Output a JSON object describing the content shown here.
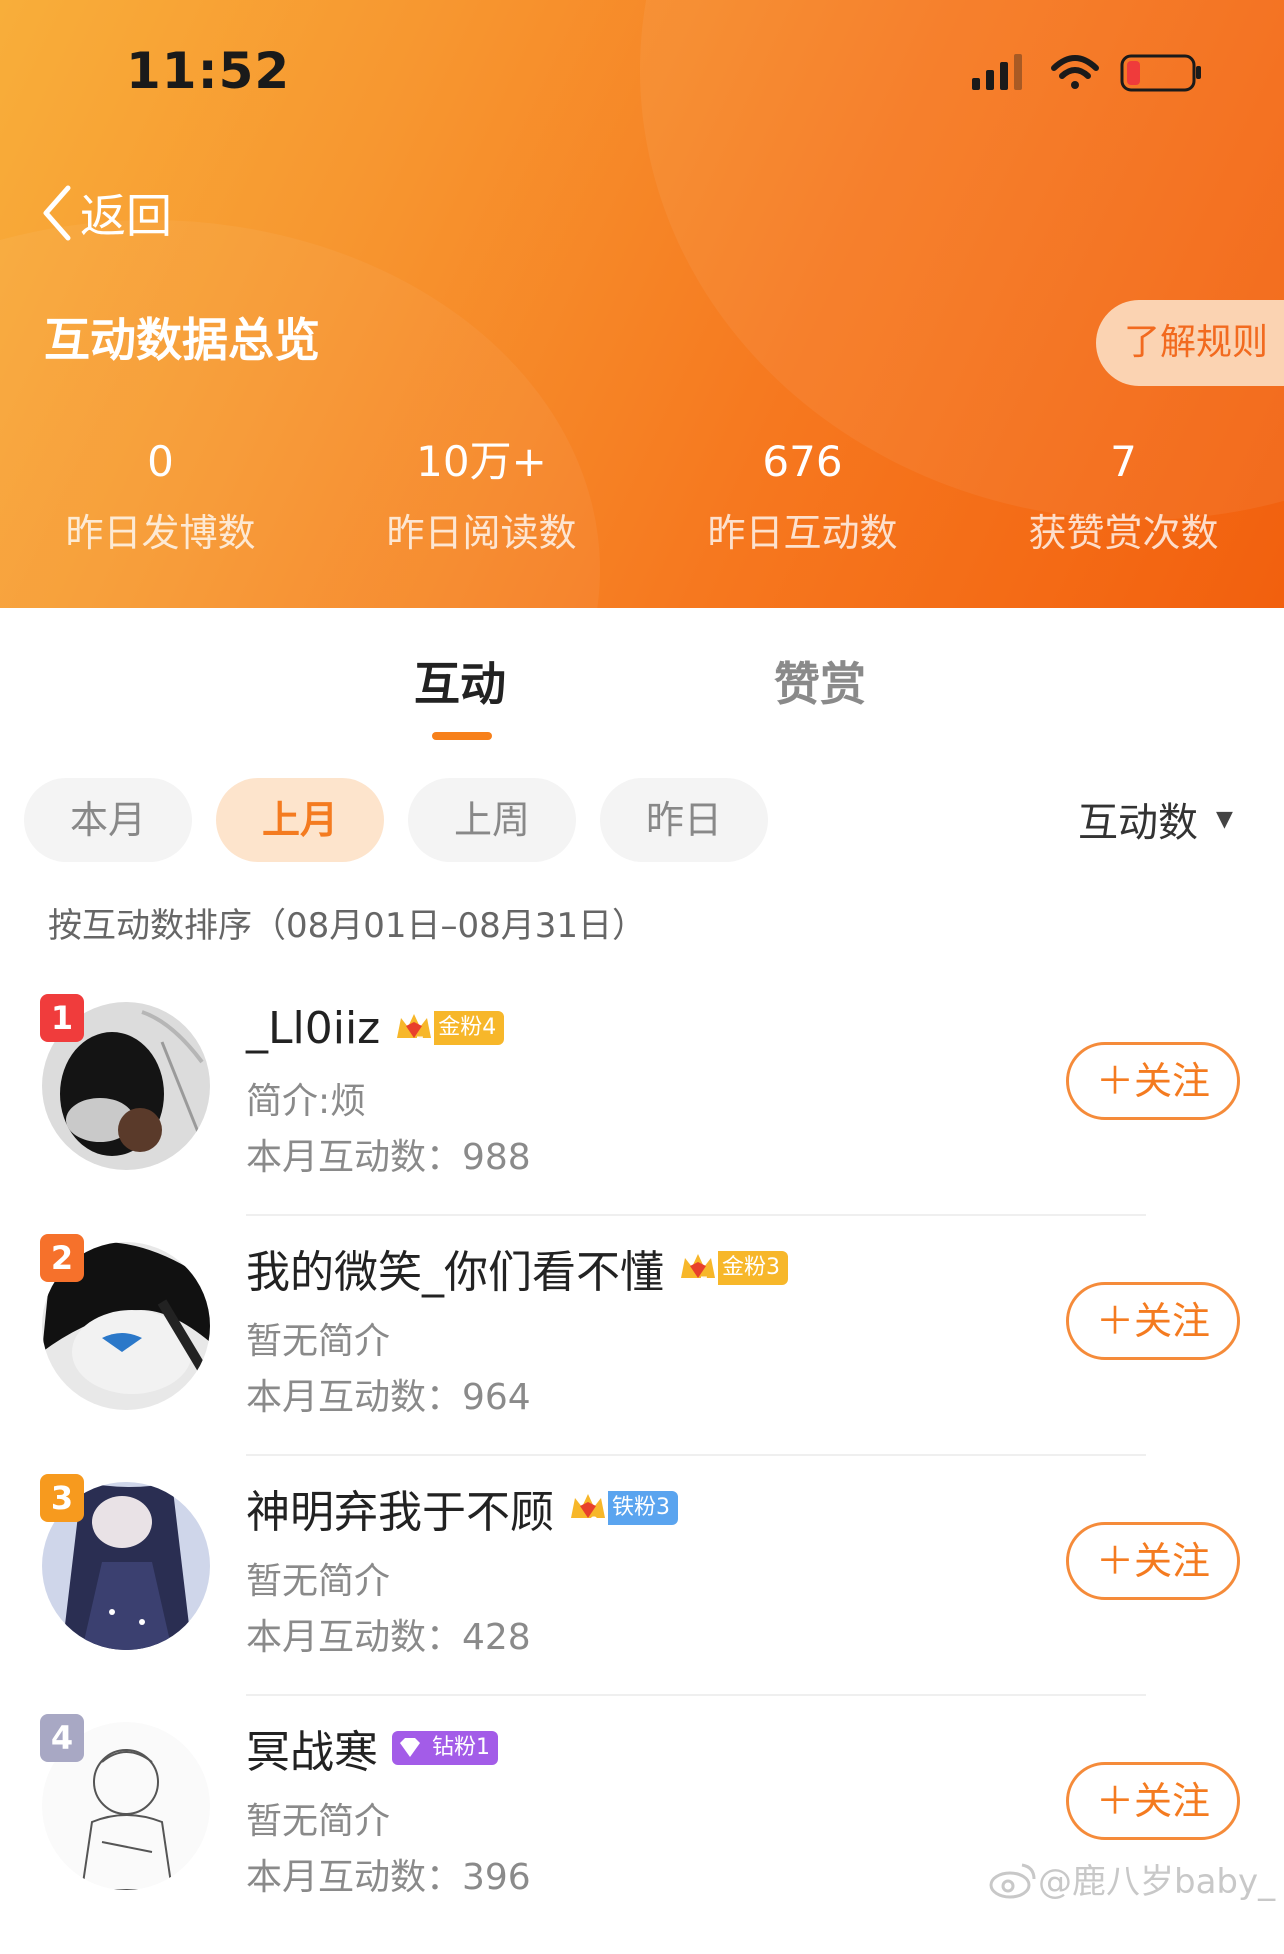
{
  "status_bar": {
    "time": "11:52"
  },
  "nav": {
    "back_label": "返回"
  },
  "header": {
    "title": "互动数据总览",
    "rule_button": "了解规则",
    "stats": [
      {
        "value": "0",
        "label": "昨日发博数"
      },
      {
        "value": "10万+",
        "label": "昨日阅读数"
      },
      {
        "value": "676",
        "label": "昨日互动数"
      },
      {
        "value": "7",
        "label": "获赞赏次数"
      }
    ]
  },
  "tabs": [
    {
      "label": "互动",
      "active": true
    },
    {
      "label": "赞赏",
      "active": false
    }
  ],
  "filters": {
    "periods": [
      {
        "label": "本月",
        "active": false
      },
      {
        "label": "上月",
        "active": true
      },
      {
        "label": "上周",
        "active": false
      },
      {
        "label": "昨日",
        "active": false
      }
    ],
    "sort_label": "互动数",
    "range_text": "按互动数排序（08月01日–08月31日）"
  },
  "list": [
    {
      "rank": "1",
      "name": "_Ll0iiz",
      "badge": "金粉4",
      "badge_level": "5",
      "bio": "简介:烦",
      "count": "本月互动数：988",
      "follow": "＋关注",
      "rank_color": "#f03c3c",
      "badge_color": "#f7b72a"
    },
    {
      "rank": "2",
      "name": "我的微笑_你们看不懂",
      "badge": "金粉3",
      "badge_level": "5",
      "bio": "暂无简介",
      "count": "本月互动数：964",
      "follow": "＋关注",
      "rank_color": "#f6712b",
      "badge_color": "#f7b72a"
    },
    {
      "rank": "3",
      "name": "神明弃我于不顾",
      "badge": "铁粉3",
      "badge_level": "2",
      "bio": "暂无简介",
      "count": "本月互动数：428",
      "follow": "＋关注",
      "rank_color": "#f79a1e",
      "badge_color": "#5aa4ef"
    },
    {
      "rank": "4",
      "name": "冥战寒",
      "badge": "钻粉1",
      "badge_level": "",
      "bio": "暂无简介",
      "count": "本月互动数：396",
      "follow": "＋关注",
      "rank_color": "#a8a8c4",
      "badge_color": "#a35ce8"
    }
  ],
  "watermark": "@鹿八岁baby_"
}
